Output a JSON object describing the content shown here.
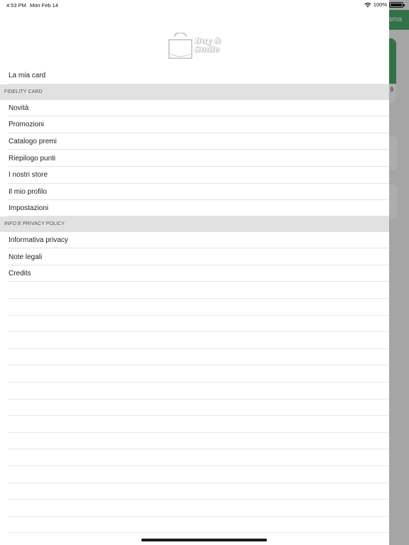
{
  "status_bar": {
    "time": "4:53 PM",
    "date": "Mon Feb 14",
    "battery": "100%"
  },
  "background_app": {
    "header_partial_text": "ama",
    "card_partial_text": "9"
  },
  "logo": {
    "line1": "Buy &",
    "line2": "Smile"
  },
  "menu": {
    "my_card": "La mia card",
    "section_fidelity": "FIDELITY CARD",
    "fidelity_items": [
      "Novità",
      "Promozioni",
      "Catalogo premi",
      "Riepilogo punti",
      "I nostri store",
      "Il mio profilo",
      "Impostazioni"
    ],
    "section_info": "INFO E PRIVACY POLICY",
    "info_items": [
      "Informativa privacy",
      "Note legali",
      "Credits"
    ]
  },
  "colors": {
    "accent": "#4aa96c",
    "section_bg": "#e1e1e1",
    "separator": "#e3e3e3"
  }
}
